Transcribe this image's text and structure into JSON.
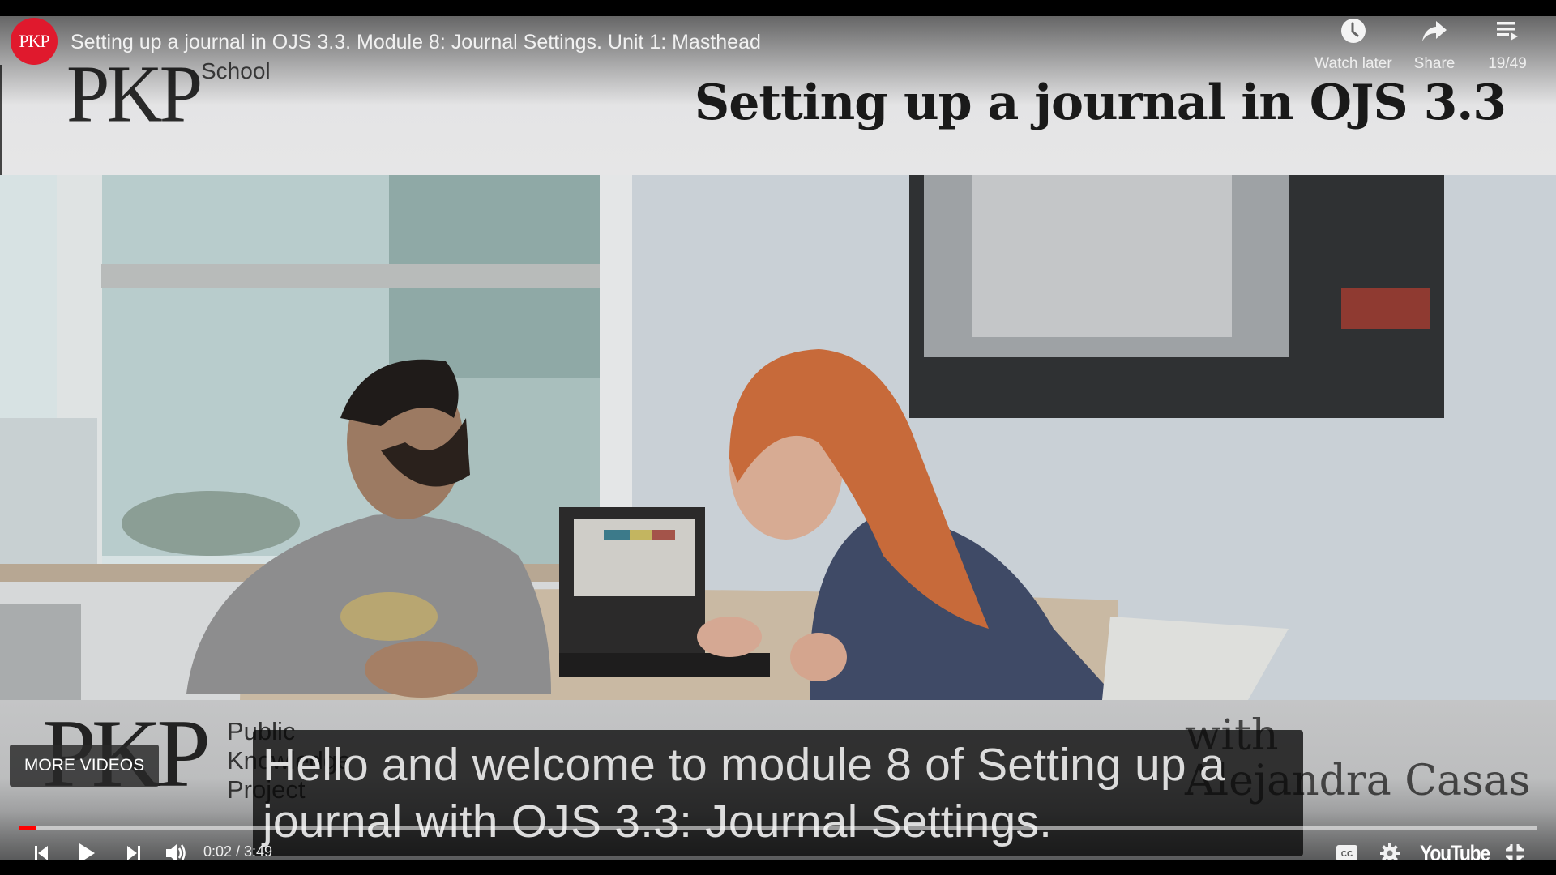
{
  "player": {
    "channel_avatar_text": "PKP",
    "video_title": "Setting up a journal in OJS 3.3. Module 8: Journal Settings. Unit 1: Masthead",
    "top_actions": [
      {
        "label": "Watch later",
        "icon": "clock-icon"
      },
      {
        "label": "Share",
        "icon": "share-arrow-icon"
      },
      {
        "label": "19/49",
        "icon": "playlist-icon"
      }
    ],
    "more_videos_label": "MORE VIDEOS",
    "progress_fraction": 0.0087,
    "current_time": "0:02",
    "duration": "3:49",
    "time_display": "0:02 / 3:49",
    "brand_logo": "YouTube",
    "controls": [
      "previous-icon",
      "play-icon",
      "next-icon",
      "volume-icon",
      "closed-captions-icon",
      "settings-gear-icon",
      "exit-fullscreen-icon"
    ],
    "accent_color": "#ff0000"
  },
  "slide": {
    "logo_main": "PKP",
    "logo_sub": "School",
    "title": "Setting up a journal in OJS 3.3",
    "footer_logo": "PKP",
    "footer_logo_text": [
      "Public",
      "Knowledge",
      "Project"
    ],
    "with_label": "with",
    "presenter": "Alejandra Casas"
  },
  "caption": {
    "lines": [
      "Hello and welcome to module 8 of Setting up a",
      "journal with OJS 3.3: Journal Settings."
    ]
  }
}
